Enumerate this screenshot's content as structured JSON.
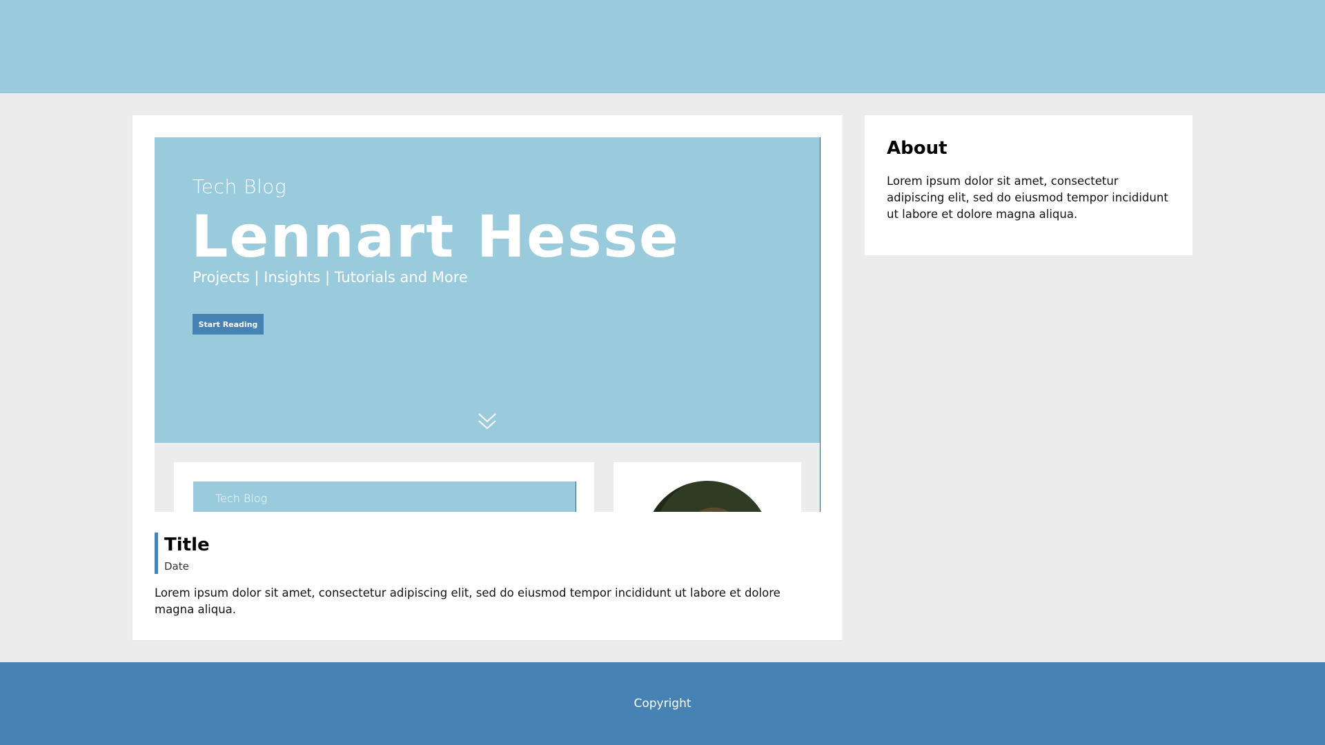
{
  "colors": {
    "header_bg": "#9acbdc",
    "page_bg": "#ececec",
    "accent": "#4682b4",
    "card_bg": "#ffffff"
  },
  "hero": {
    "kicker": "Tech Blog",
    "title": "Lennart Hesse",
    "subtitle": "Projects | Insights | Tutorials and More",
    "button_label": "Start Reading",
    "scroll_icon": "double-chevron-down-icon"
  },
  "preview": {
    "mini_kicker": "Tech Blog"
  },
  "post": {
    "title": "Title",
    "date": "Date",
    "body": "Lorem ipsum dolor sit amet, consectetur adipiscing elit, sed do eiusmod tempor incididunt ut labore et dolore magna aliqua."
  },
  "about": {
    "title": "About",
    "text": "Lorem ipsum dolor sit amet, consectetur adipiscing elit, sed do eiusmod tempor incididunt ut labore et dolore magna aliqua."
  },
  "footer": {
    "text": "Copyright"
  }
}
